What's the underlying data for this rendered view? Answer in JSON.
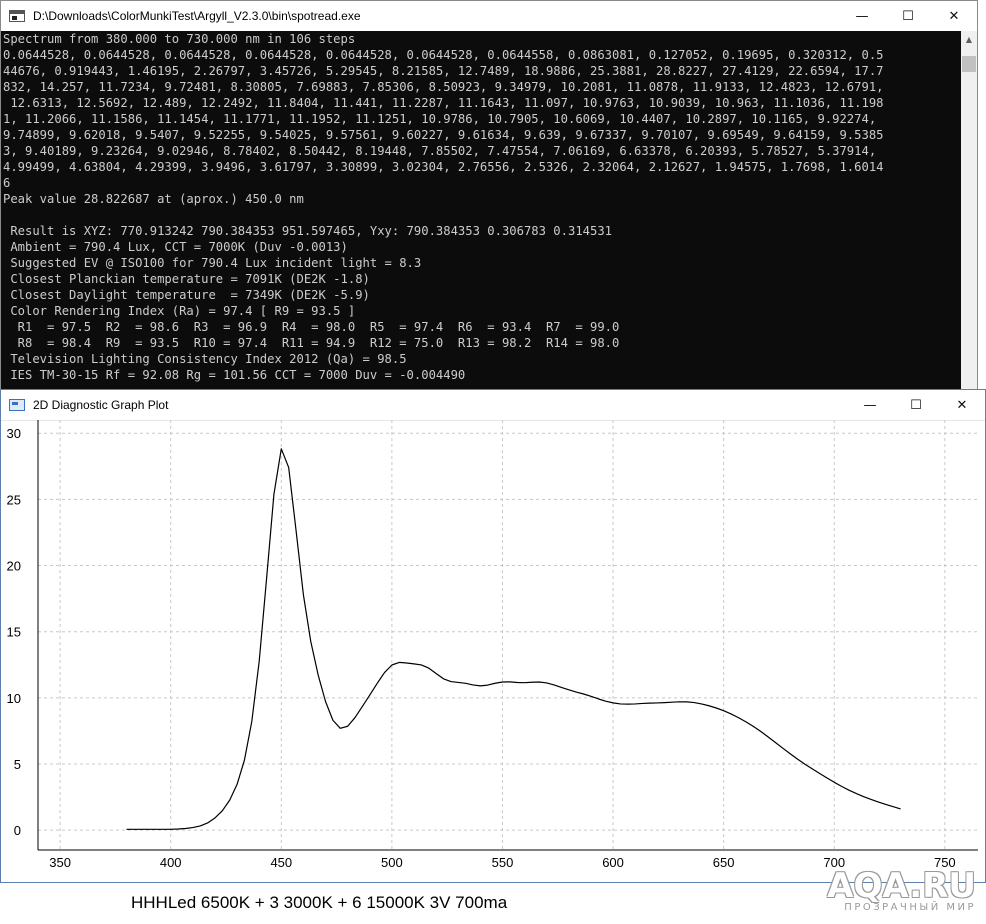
{
  "console_window": {
    "title": "D:\\Downloads\\ColorMunkiTest\\Argyll_V2.3.0\\bin\\spotread.exe",
    "buttons": {
      "minimize": "—",
      "maximize": "☐",
      "close": "✕"
    },
    "lines": [
      "Spectrum from 380.000 to 730.000 nm in 106 steps",
      "0.0644528, 0.0644528, 0.0644528, 0.0644528, 0.0644528, 0.0644528, 0.0644558, 0.0863081, 0.127052, 0.19695, 0.320312, 0.5",
      "44676, 0.919443, 1.46195, 2.26797, 3.45726, 5.29545, 8.21585, 12.7489, 18.9886, 25.3881, 28.8227, 27.4129, 22.6594, 17.7",
      "832, 14.257, 11.7234, 9.72481, 8.30805, 7.69883, 7.85306, 8.50923, 9.34979, 10.2081, 11.0878, 11.9133, 12.4823, 12.6791,",
      " 12.6313, 12.5692, 12.489, 12.2492, 11.8404, 11.441, 11.2287, 11.1643, 11.097, 10.9763, 10.9039, 10.963, 11.1036, 11.198",
      "1, 11.2066, 11.1586, 11.1454, 11.1771, 11.1952, 11.1251, 10.9786, 10.7905, 10.6069, 10.4407, 10.2897, 10.1165, 9.92274,",
      "9.74899, 9.62018, 9.5407, 9.52255, 9.54025, 9.57561, 9.60227, 9.61634, 9.639, 9.67337, 9.70107, 9.69549, 9.64159, 9.5385",
      "3, 9.40189, 9.23264, 9.02946, 8.78402, 8.50442, 8.19448, 7.85502, 7.47554, 7.06169, 6.63378, 6.20393, 5.78527, 5.37914,",
      "4.99499, 4.63804, 4.29399, 3.9496, 3.61797, 3.30899, 3.02304, 2.76556, 2.5326, 2.32064, 2.12627, 1.94575, 1.7698, 1.6014",
      "6",
      "Peak value 28.822687 at (aprox.) 450.0 nm",
      "",
      " Result is XYZ: 770.913242 790.384353 951.597465, Yxy: 790.384353 0.306783 0.314531",
      " Ambient = 790.4 Lux, CCT = 7000K (Duv -0.0013)",
      " Suggested EV @ ISO100 for 790.4 Lux incident light = 8.3",
      " Closest Planckian temperature = 7091K (DE2K -1.8)",
      " Closest Daylight temperature  = 7349K (DE2K -5.9)",
      " Color Rendering Index (Ra) = 97.4 [ R9 = 93.5 ]",
      "  R1  = 97.5  R2  = 98.6  R3  = 96.9  R4  = 98.0  R5  = 97.4  R6  = 93.4  R7  = 99.0",
      "  R8  = 98.4  R9  = 93.5  R10 = 97.4  R11 = 94.9  R12 = 75.0  R13 = 98.2  R14 = 98.0",
      " Television Lighting Consistency Index 2012 (Qa) = 98.5",
      " IES TM-30-15 Rf = 92.08 Rg = 101.56 CCT = 7000 Duv = -0.004490"
    ]
  },
  "plot_window": {
    "title": "2D Diagnostic Graph Plot",
    "buttons": {
      "minimize": "—",
      "maximize": "☐",
      "close": "✕"
    }
  },
  "chart_data": {
    "type": "line",
    "title": "",
    "xlabel": "",
    "ylabel": "",
    "xlim": [
      340,
      765
    ],
    "ylim": [
      -1.5,
      31
    ],
    "x_ticks": [
      350,
      400,
      450,
      500,
      550,
      600,
      650,
      700,
      750
    ],
    "y_ticks": [
      0,
      5,
      10,
      15,
      20,
      25,
      30
    ],
    "grid": true,
    "line_color": "#000000",
    "series": [
      {
        "x_start": 380,
        "x_step": 3.3333333,
        "values": [
          0.0644528,
          0.0644528,
          0.0644528,
          0.0644528,
          0.0644528,
          0.0644528,
          0.0644558,
          0.0863081,
          0.127052,
          0.19695,
          0.320312,
          0.544676,
          0.919443,
          1.46195,
          2.26797,
          3.45726,
          5.29545,
          8.21585,
          12.7489,
          18.9886,
          25.3881,
          28.8227,
          27.4129,
          22.6594,
          17.7832,
          14.257,
          11.7234,
          9.72481,
          8.30805,
          7.69883,
          7.85306,
          8.50923,
          9.34979,
          10.2081,
          11.0878,
          11.9133,
          12.4823,
          12.6791,
          12.6313,
          12.5692,
          12.489,
          12.2492,
          11.8404,
          11.441,
          11.2287,
          11.1643,
          11.097,
          10.9763,
          10.9039,
          10.963,
          11.1036,
          11.1981,
          11.2066,
          11.1586,
          11.1454,
          11.1771,
          11.1952,
          11.1251,
          10.9786,
          10.7905,
          10.6069,
          10.4407,
          10.2897,
          10.1165,
          9.92274,
          9.74899,
          9.62018,
          9.5407,
          9.52255,
          9.54025,
          9.57561,
          9.60227,
          9.61634,
          9.639,
          9.67337,
          9.70107,
          9.69549,
          9.64159,
          9.53853,
          9.40189,
          9.23264,
          9.02946,
          8.78402,
          8.50442,
          8.19448,
          7.85502,
          7.47554,
          7.06169,
          6.63378,
          6.20393,
          5.78527,
          5.37914,
          4.99499,
          4.63804,
          4.29399,
          3.9496,
          3.61797,
          3.30899,
          3.02304,
          2.76556,
          2.5326,
          2.32064,
          2.12627,
          1.94575,
          1.7698,
          1.60146
        ]
      }
    ]
  },
  "caption": "HHHLed 6500K + 3 3000K + 6 15000K 3V 700ma",
  "watermark": {
    "main": "AQA.RU",
    "sub": "ПРОЗРАЧНЫЙ МИР"
  }
}
